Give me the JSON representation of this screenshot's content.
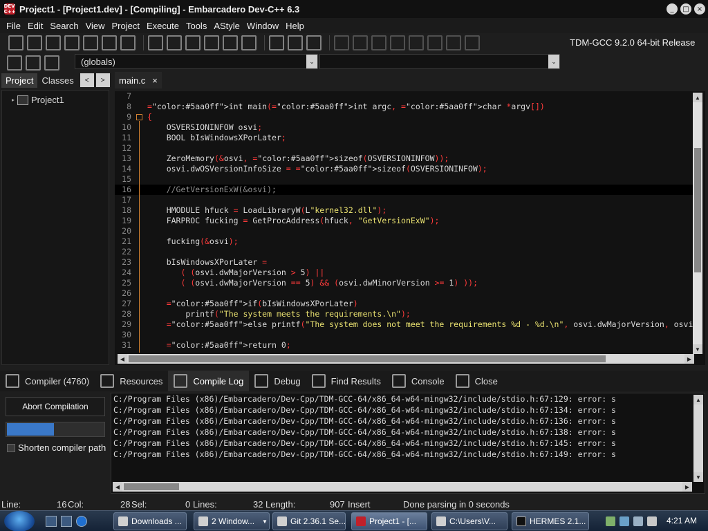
{
  "window": {
    "app_icon_text": "DEV C++",
    "title": "Project1 - [Project1.dev] - [Compiling] - Embarcadero Dev-C++ 6.3",
    "controls": [
      "_",
      "□",
      "×"
    ]
  },
  "menu": [
    "File",
    "Edit",
    "Search",
    "View",
    "Project",
    "Execute",
    "Tools",
    "AStyle",
    "Window",
    "Help"
  ],
  "toolbar": {
    "compiler": "TDM-GCC 9.2.0 64-bit Release",
    "scope": "(globals)",
    "dropdown_arrow": "⌄"
  },
  "left_panel": {
    "tabs": [
      "Project",
      "Classes"
    ],
    "nav_prev": "<",
    "nav_next": ">",
    "tree_root": "Project1"
  },
  "editor": {
    "tab": "main.c",
    "tab_close": "×",
    "active_line": 16,
    "lines": [
      {
        "n": "7",
        "code": ""
      },
      {
        "n": "8",
        "code": "int main(int argc, char *argv[])"
      },
      {
        "n": "9",
        "code": "{"
      },
      {
        "n": "10",
        "code": "    OSVERSIONINFOW osvi;"
      },
      {
        "n": "11",
        "code": "    BOOL bIsWindowsXPorLater;"
      },
      {
        "n": "12",
        "code": ""
      },
      {
        "n": "13",
        "code": "    ZeroMemory(&osvi, sizeof(OSVERSIONINFOW));"
      },
      {
        "n": "14",
        "code": "    osvi.dwOSVersionInfoSize = sizeof(OSVERSIONINFOW);"
      },
      {
        "n": "15",
        "code": ""
      },
      {
        "n": "16",
        "code": "    //GetVersionExW(&osvi);"
      },
      {
        "n": "17",
        "code": ""
      },
      {
        "n": "18",
        "code": "    HMODULE hfuck = LoadLibraryW(L\"kernel32.dll\");"
      },
      {
        "n": "19",
        "code": "    FARPROC fucking = GetProcAddress(hfuck, \"GetVersionExW\");"
      },
      {
        "n": "20",
        "code": ""
      },
      {
        "n": "21",
        "code": "    fucking(&osvi);"
      },
      {
        "n": "22",
        "code": ""
      },
      {
        "n": "23",
        "code": "    bIsWindowsXPorLater ="
      },
      {
        "n": "24",
        "code": "       ( (osvi.dwMajorVersion > 5) ||"
      },
      {
        "n": "25",
        "code": "       ( (osvi.dwMajorVersion == 5) && (osvi.dwMinorVersion >= 1) ));"
      },
      {
        "n": "26",
        "code": ""
      },
      {
        "n": "27",
        "code": "    if(bIsWindowsXPorLater)"
      },
      {
        "n": "28",
        "code": "        printf(\"The system meets the requirements.\\n\");"
      },
      {
        "n": "29",
        "code": "    else printf(\"The system does not meet the requirements %d - %d.\\n\", osvi.dwMajorVersion, osvi.d"
      },
      {
        "n": "30",
        "code": ""
      },
      {
        "n": "31",
        "code": "    return 0;"
      }
    ]
  },
  "bottom_tabs": [
    {
      "label": "Compiler (4760)",
      "icon": "grid-icon"
    },
    {
      "label": "Resources",
      "icon": "resources-icon"
    },
    {
      "label": "Compile Log",
      "icon": "chart-icon"
    },
    {
      "label": "Debug",
      "icon": "check-icon"
    },
    {
      "label": "Find Results",
      "icon": "find-icon"
    },
    {
      "label": "Console",
      "icon": "console-icon"
    },
    {
      "label": "Close",
      "icon": "close-icon"
    }
  ],
  "compile_panel": {
    "abort_label": "Abort Compilation",
    "progress": 0.48,
    "shorten_label": "Shorten compiler path"
  },
  "compile_log": [
    "C:/Program Files (x86)/Embarcadero/Dev-Cpp/TDM-GCC-64/x86_64-w64-mingw32/include/stdio.h:67:129: error: s",
    "C:/Program Files (x86)/Embarcadero/Dev-Cpp/TDM-GCC-64/x86_64-w64-mingw32/include/stdio.h:67:134: error: s",
    "C:/Program Files (x86)/Embarcadero/Dev-Cpp/TDM-GCC-64/x86_64-w64-mingw32/include/stdio.h:67:136: error: s",
    "C:/Program Files (x86)/Embarcadero/Dev-Cpp/TDM-GCC-64/x86_64-w64-mingw32/include/stdio.h:67:138: error: s",
    "C:/Program Files (x86)/Embarcadero/Dev-Cpp/TDM-GCC-64/x86_64-w64-mingw32/include/stdio.h:67:145: error: s",
    "C:/Program Files (x86)/Embarcadero/Dev-Cpp/TDM-GCC-64/x86_64-w64-mingw32/include/stdio.h:67:149: error: s"
  ],
  "status": {
    "line_label": "Line:",
    "line": "16",
    "col_label": "Col:",
    "col": "28",
    "sel_label": "Sel:",
    "sel": "0",
    "lines_label": "Lines:",
    "lines": "32",
    "length_label": "Length:",
    "length": "907",
    "mode": "Insert",
    "message": "Done parsing in 0 seconds"
  },
  "taskbar": {
    "items": [
      "Downloads ...",
      "2 Window...",
      "Git 2.36.1 Se...",
      "Project1 - [...",
      "C:\\Users\\V...",
      "HERMES 2.1..."
    ],
    "active_index": 3,
    "clock": "4:21 AM"
  },
  "colors": {
    "keyword": "#5aa0ff",
    "string": "#e8e070",
    "operator": "#ff3b3b",
    "fold": "#d08030",
    "progress": "#3a78c8"
  }
}
